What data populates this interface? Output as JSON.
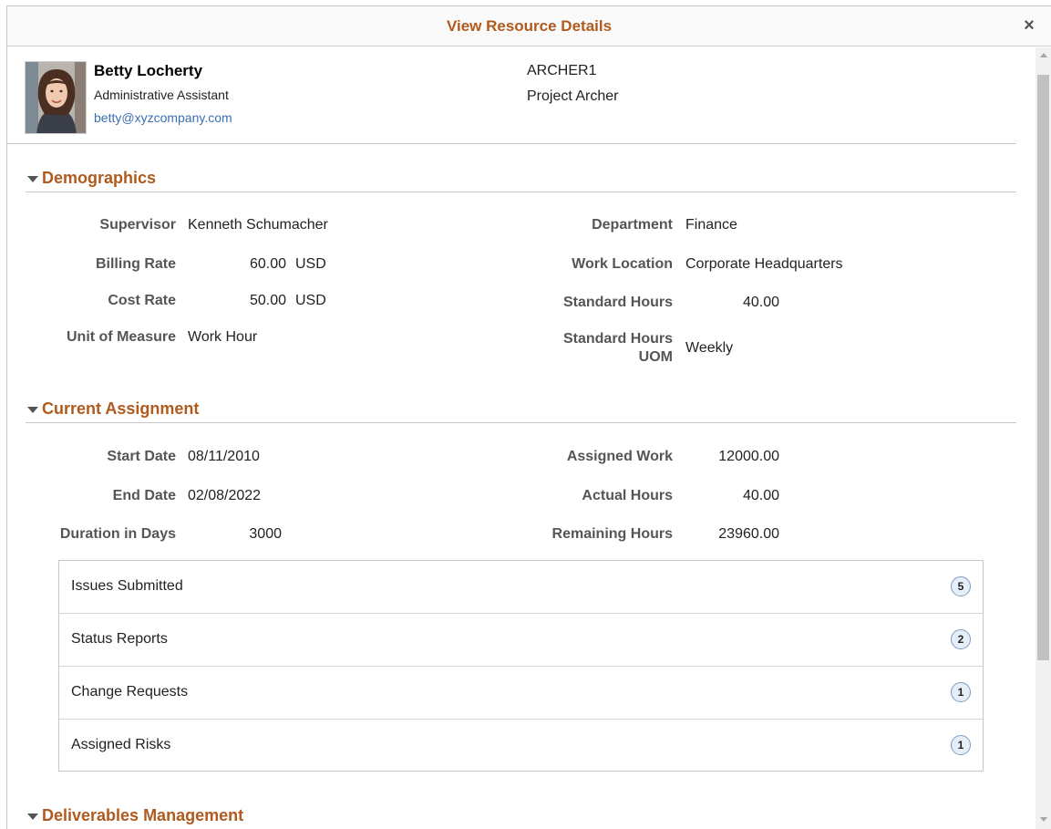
{
  "dialog": {
    "title": "View Resource Details",
    "close_label": "×"
  },
  "profile": {
    "name": "Betty Locherty",
    "job_title": "Administrative Assistant",
    "email": "betty@xyzcompany.com",
    "project_code": "ARCHER1",
    "project_name": "Project Archer"
  },
  "demographics": {
    "title": "Demographics",
    "supervisor_label": "Supervisor",
    "supervisor_value": "Kenneth Schumacher",
    "billing_rate_label": "Billing Rate",
    "billing_rate_value": "60.00",
    "billing_rate_currency": "USD",
    "cost_rate_label": "Cost Rate",
    "cost_rate_value": "50.00",
    "cost_rate_currency": "USD",
    "uom_label": "Unit of Measure",
    "uom_value": "Work Hour",
    "department_label": "Department",
    "department_value": "Finance",
    "work_location_label": "Work Location",
    "work_location_value": "Corporate Headquarters",
    "standard_hours_label": "Standard Hours",
    "standard_hours_value": "40.00",
    "standard_hours_uom_label_1": "Standard Hours",
    "standard_hours_uom_label_2": "UOM",
    "standard_hours_uom_value": "Weekly"
  },
  "assignment": {
    "title": "Current Assignment",
    "start_date_label": "Start Date",
    "start_date_value": "08/11/2010",
    "end_date_label": "End Date",
    "end_date_value": "02/08/2022",
    "duration_label": "Duration in Days",
    "duration_value": "3000",
    "assigned_work_label": "Assigned Work",
    "assigned_work_value": "12000.00",
    "actual_hours_label": "Actual Hours",
    "actual_hours_value": "40.00",
    "remaining_hours_label": "Remaining Hours",
    "remaining_hours_value": "23960.00",
    "items": [
      {
        "label": "Issues Submitted",
        "count": "5"
      },
      {
        "label": "Status Reports",
        "count": "2"
      },
      {
        "label": "Change Requests",
        "count": "1"
      },
      {
        "label": "Assigned Risks",
        "count": "1"
      }
    ]
  },
  "deliverables": {
    "title": "Deliverables Management"
  },
  "colors": {
    "accent": "#b05a1e",
    "link": "#3a6fb0",
    "badge_bg": "#e6eef8"
  }
}
